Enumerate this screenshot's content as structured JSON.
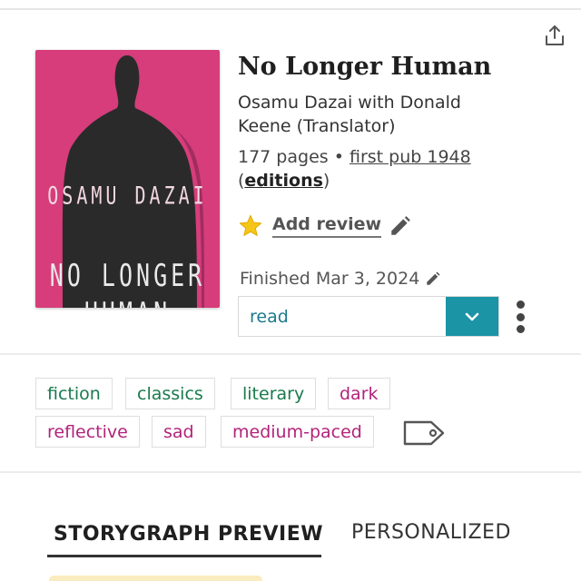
{
  "book": {
    "title": "No Longer Human",
    "authors": "Osamu Dazai with Donald Keene (Translator)",
    "pages": "177 pages",
    "separator": "•",
    "first_pub": "first pub 1948",
    "editions_open": "(",
    "editions": "editions",
    "editions_close": ")",
    "cover": {
      "author_text": "OSAMU DAZAI",
      "title_line1": "NO LONGER",
      "title_line2": "HUMAN",
      "background_color": "#d63d7a"
    }
  },
  "review": {
    "add_review_label": "Add review"
  },
  "status": {
    "finished_text": "Finished Mar 3, 2024",
    "selected": "read"
  },
  "tags": [
    "fiction",
    "classics",
    "literary",
    "dark",
    "reflective",
    "sad",
    "medium-paced"
  ],
  "tabs": {
    "preview": "STORYGRAPH PREVIEW",
    "personalized": "PERSONALIZED"
  },
  "colors": {
    "accent_teal": "#1b94a6",
    "tag_green": "#1a7a4c",
    "tag_pink": "#b2237a",
    "star": "#f5c518"
  },
  "icons": [
    "share-icon",
    "star-icon",
    "pencil-icon",
    "chevron-down-icon",
    "more-vertical-icon",
    "tag-icon"
  ]
}
